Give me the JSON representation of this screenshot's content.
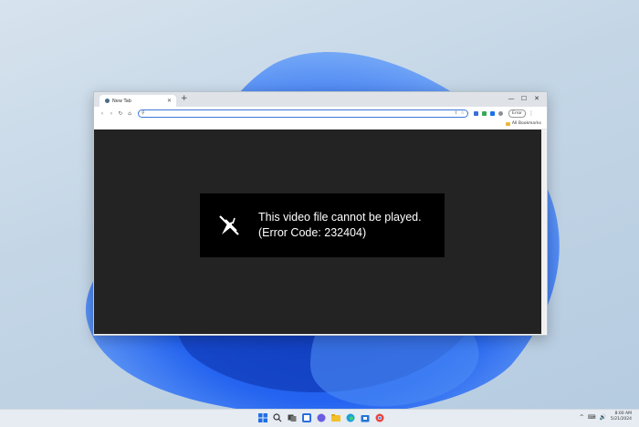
{
  "browser": {
    "tab_title": "New Tab",
    "new_tab_label": "+",
    "window_controls": {
      "minimize": "—",
      "maximize": "☐",
      "close": "✕"
    },
    "tab_close": "✕"
  },
  "toolbar": {
    "back": "‹",
    "forward": "›",
    "reload": "↻",
    "home": "⌂",
    "search_icon": "⚲",
    "address_value": "",
    "error_button": "Error",
    "menu": "⋮"
  },
  "bookmarks_bar": {
    "all_bookmarks": "All Bookmarks"
  },
  "video_error": {
    "line1": "This video file cannot be played.",
    "line2": "(Error Code: 232404)"
  },
  "taskbar": {
    "tray_chevron": "^",
    "tray_network": "⌨",
    "tray_volume": "🔊",
    "time": "8:00 AM",
    "date": "5/21/2024"
  },
  "colors": {
    "accent_blue": "#2f6fe4",
    "video_bg": "#232323",
    "error_box": "#000000"
  }
}
